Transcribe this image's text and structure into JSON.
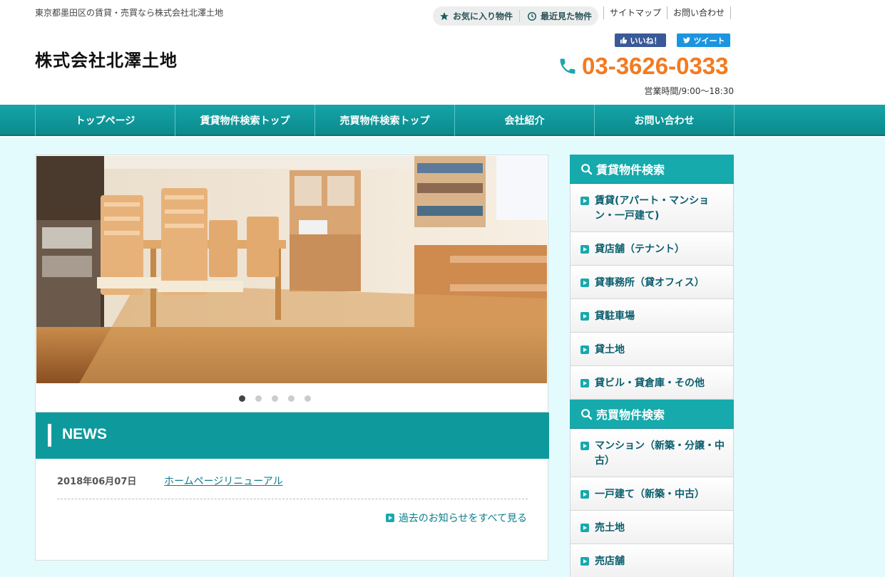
{
  "header": {
    "tagline": "東京都墨田区の賃貸・売買なら株式会社北澤土地",
    "site_title": "株式会社北澤土地",
    "favorites_label": "お気に入り物件",
    "recent_label": "最近見た物件",
    "sitemap_label": "サイトマップ",
    "contact_label": "お問い合わせ",
    "like_label": "いいね！",
    "tweet_label": "ツイート",
    "phone": "03-3626-0333",
    "hours": "営業時間/9:00～18:30"
  },
  "nav": {
    "items": [
      {
        "label": "トップページ"
      },
      {
        "label": "賃貸物件検索トップ"
      },
      {
        "label": "売買物件検索トップ"
      },
      {
        "label": "会社紹介"
      },
      {
        "label": "お問い合わせ"
      }
    ]
  },
  "slider": {
    "slide_count": 5,
    "active_index": 0
  },
  "news": {
    "title": "NEWS",
    "items": [
      {
        "date": "2018年06月07日",
        "title": "ホームページリニューアル"
      }
    ],
    "more_label": "過去のお知らせをすべて見る"
  },
  "sidebar": {
    "rent": {
      "title": "賃貸物件検索",
      "items": [
        {
          "label": "賃貸(アパート・マンション・一戸建て)"
        },
        {
          "label": "貸店舗（テナント）"
        },
        {
          "label": "貸事務所（貸オフィス）"
        },
        {
          "label": "貸駐車場"
        },
        {
          "label": "貸土地"
        },
        {
          "label": "貸ビル・貸倉庫・その他"
        }
      ]
    },
    "sale": {
      "title": "売買物件検索",
      "items": [
        {
          "label": "マンション（新築・分譲・中古）"
        },
        {
          "label": "一戸建て（新築・中古）"
        },
        {
          "label": "売土地"
        },
        {
          "label": "売店舗"
        }
      ]
    }
  },
  "colors": {
    "accent": "#16aaad",
    "phone": "#f47a20",
    "content_bg": "#e4fbfd"
  }
}
